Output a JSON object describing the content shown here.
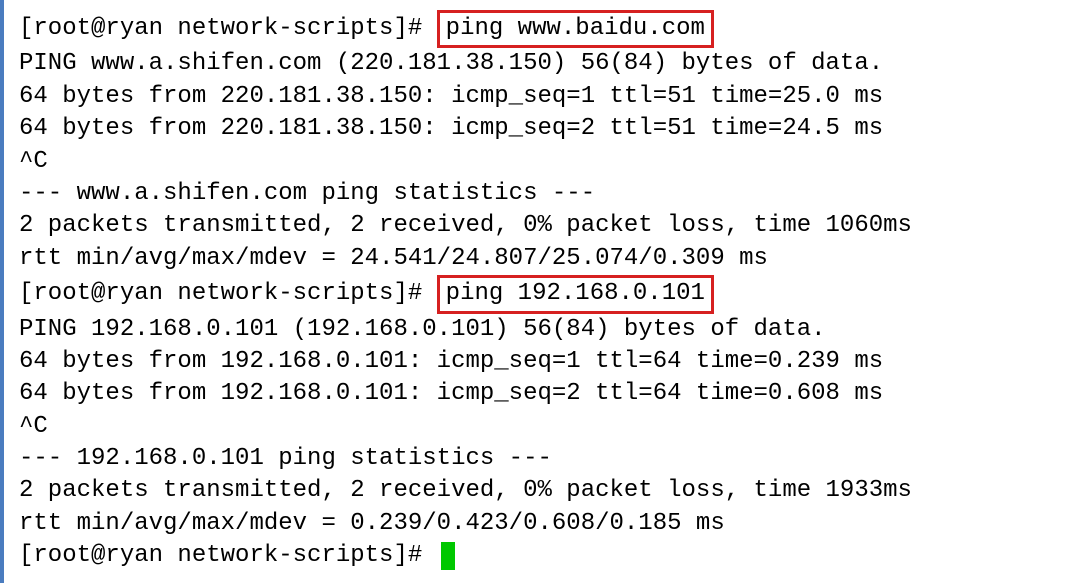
{
  "terminal": {
    "prompt1": "[root@ryan network-scripts]# ",
    "cmd1": "ping www.baidu.com",
    "output1": [
      "PING www.a.shifen.com (220.181.38.150) 56(84) bytes of data.",
      "64 bytes from 220.181.38.150: icmp_seq=1 ttl=51 time=25.0 ms",
      "64 bytes from 220.181.38.150: icmp_seq=2 ttl=51 time=24.5 ms",
      "^C",
      "--- www.a.shifen.com ping statistics ---",
      "2 packets transmitted, 2 received, 0% packet loss, time 1060ms",
      "rtt min/avg/max/mdev = 24.541/24.807/25.074/0.309 ms"
    ],
    "prompt2": "[root@ryan network-scripts]# ",
    "cmd2": "ping 192.168.0.101",
    "output2": [
      "PING 192.168.0.101 (192.168.0.101) 56(84) bytes of data.",
      "64 bytes from 192.168.0.101: icmp_seq=1 ttl=64 time=0.239 ms",
      "64 bytes from 192.168.0.101: icmp_seq=2 ttl=64 time=0.608 ms",
      "^C",
      "--- 192.168.0.101 ping statistics ---",
      "2 packets transmitted, 2 received, 0% packet loss, time 1933ms",
      "rtt min/avg/max/mdev = 0.239/0.423/0.608/0.185 ms"
    ],
    "prompt3": "[root@ryan network-scripts]# "
  }
}
